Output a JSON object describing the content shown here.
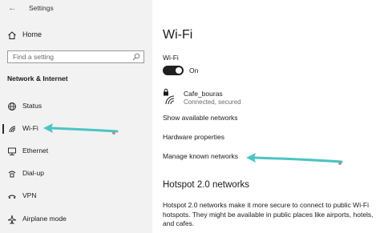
{
  "sidebar": {
    "app_title": "Settings",
    "home_label": "Home",
    "search_placeholder": "Find a setting",
    "section_header": "Network & Internet",
    "items": [
      {
        "label": "Status",
        "icon": "globe-icon"
      },
      {
        "label": "Wi-Fi",
        "icon": "wifi-icon",
        "active": true
      },
      {
        "label": "Ethernet",
        "icon": "ethernet-icon"
      },
      {
        "label": "Dial-up",
        "icon": "dialup-icon"
      },
      {
        "label": "VPN",
        "icon": "vpn-icon"
      },
      {
        "label": "Airplane mode",
        "icon": "airplane-icon"
      }
    ]
  },
  "main": {
    "title": "Wi-Fi",
    "wifi_label": "Wi-Fi",
    "toggle_state": "On",
    "toggle_on": true,
    "network": {
      "name": "Cafe_bouras",
      "status": "Connected, secured"
    },
    "links": {
      "show_available": "Show available networks",
      "hardware_properties": "Hardware properties",
      "manage_known": "Manage known networks"
    },
    "hotspot": {
      "heading": "Hotspot 2.0 networks",
      "description": "Hotspot 2.0 networks make it more secure to connect to public Wi-Fi hotspots. They might be available in public places like airports, hotels, and cafes."
    }
  },
  "colors": {
    "sidebar_bg": "#f2f2f2",
    "annotation_arrow": "#4cc4c4"
  }
}
